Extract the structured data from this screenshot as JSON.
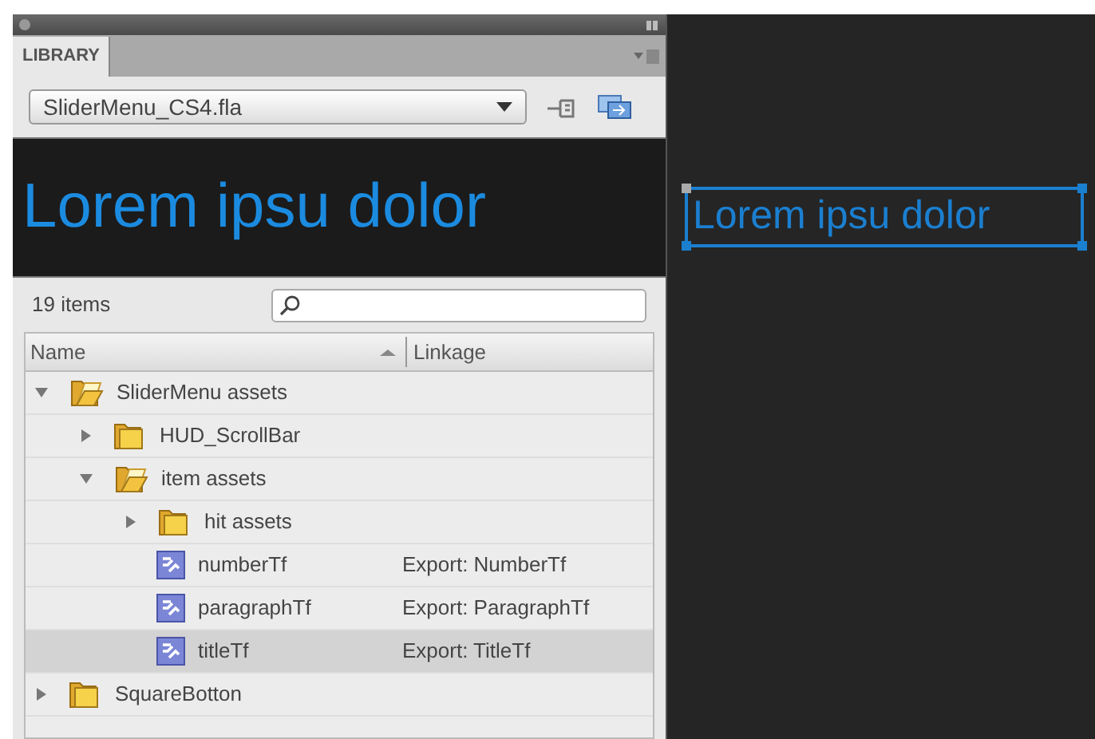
{
  "panel": {
    "tab": "LIBRARY",
    "document": "SliderMenu_CS4.fla"
  },
  "preview_text": "Lorem ipsu dolor",
  "item_count": "19 items",
  "columns": [
    "Name",
    "Linkage"
  ],
  "tree": [
    {
      "kind": "folder",
      "name": "SliderMenu assets",
      "expanded": true,
      "selected": false,
      "children": [
        {
          "kind": "folder",
          "name": "HUD_ScrollBar",
          "expanded": false,
          "selected": false
        },
        {
          "kind": "folder",
          "name": "item assets",
          "expanded": true,
          "selected": false,
          "children": [
            {
              "kind": "folder",
              "name": "hit assets",
              "expanded": false,
              "selected": false
            },
            {
              "kind": "symbol",
              "name": "numberTf",
              "linkage": "Export: NumberTf",
              "selected": false
            },
            {
              "kind": "symbol",
              "name": "paragraphTf",
              "linkage": "Export: ParagraphTf",
              "selected": false
            },
            {
              "kind": "symbol",
              "name": "titleTf",
              "linkage": "Export: TitleTf",
              "selected": true
            }
          ]
        }
      ]
    },
    {
      "kind": "folder",
      "name": "SquareBotton",
      "expanded": false,
      "selected": false
    }
  ],
  "stage": {
    "text_field": "Lorem ipsu dolor",
    "selected": true
  }
}
